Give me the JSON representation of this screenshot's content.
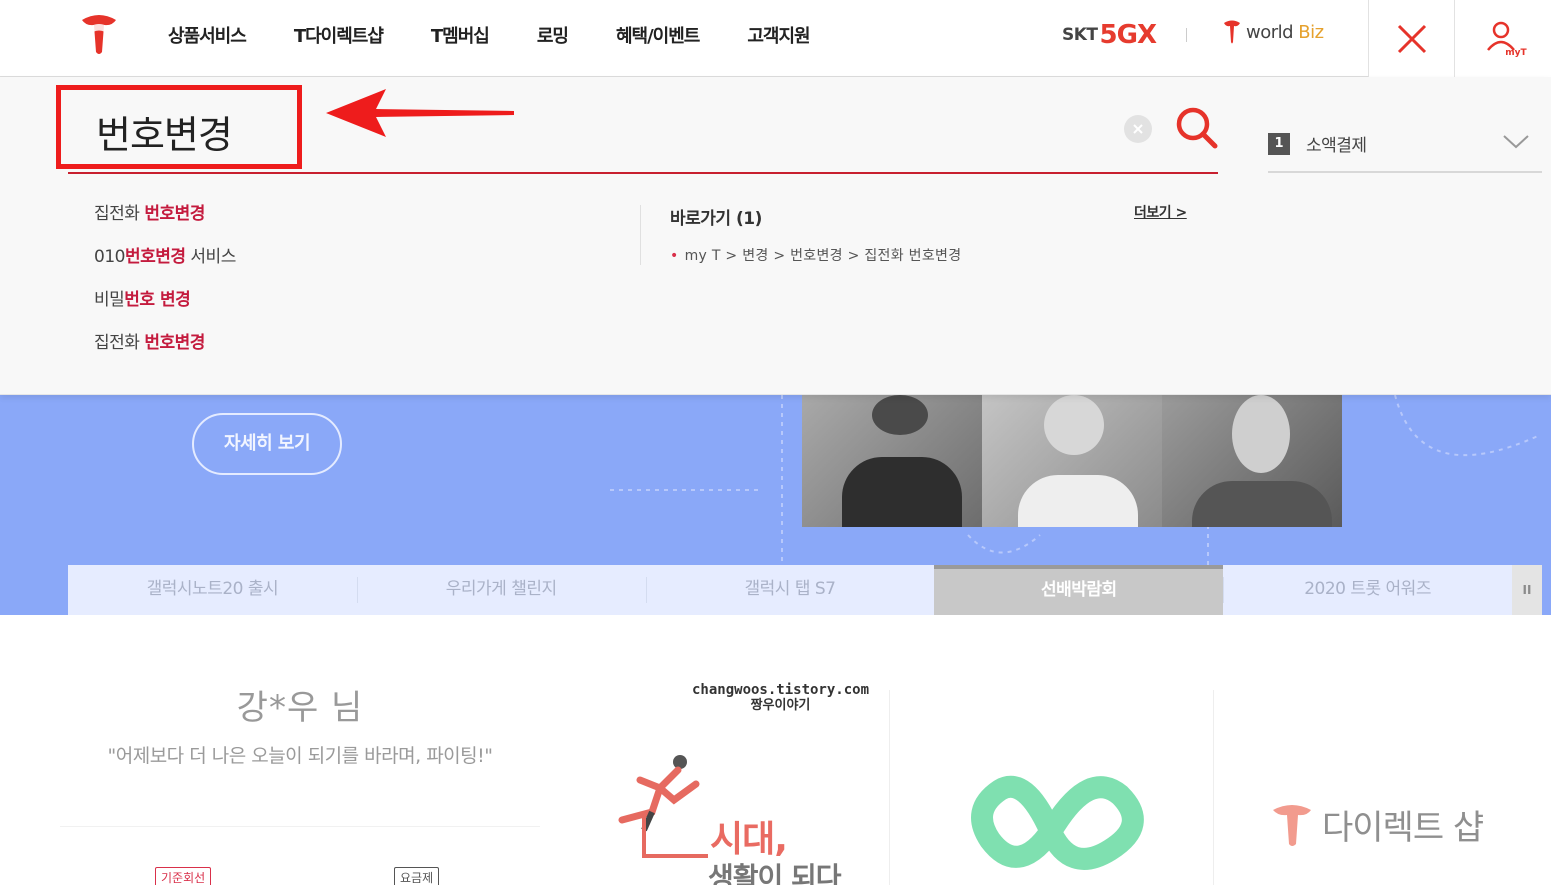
{
  "header": {
    "nav": [
      "상품서비스",
      "T다이렉트샵",
      "T멤버십",
      "로밍",
      "혜택/이벤트",
      "고객지원"
    ],
    "brand_skt": "SKT",
    "brand_5gx": "5GX",
    "brand_world": "world",
    "brand_biz": "Biz",
    "myt_label": "myT"
  },
  "search": {
    "query": "번호변경",
    "suggestions": [
      {
        "pre": "집전화 ",
        "hl": "번호변경",
        "post": ""
      },
      {
        "pre": "010",
        "hl": "번호변경",
        "post": " 서비스"
      },
      {
        "pre": "비밀",
        "hl": "번호 변경",
        "post": ""
      },
      {
        "pre": "집전화 ",
        "hl": "번호변경",
        "post": ""
      }
    ],
    "shortcut_title": "바로가기 (1)",
    "more": "더보기 >",
    "shortcut_path": "my T > 변경 > 번호변경 > 집전화 번호변경",
    "rank_num": "1",
    "rank_label": "소액결제"
  },
  "banner": {
    "detail_button": "자세히 보기",
    "tabs": [
      "갤럭시노트20 출시",
      "우리가게 챌린지",
      "갤럭시 탭 S7",
      "선배박람회",
      "2020 트롯 어워즈"
    ],
    "active_tab": 3,
    "pause": "II"
  },
  "content": {
    "greeting_name": "강*우 님",
    "greeting_msg": "\"어제보다 더 나은 오늘이 되기를 바라며, 파이팅!\"",
    "tag1": "기준회선",
    "tag2": "요금제",
    "watermark_url": "changwoos.tistory.com",
    "watermark_name": "짱우이야기",
    "promo_line1": "시대,",
    "promo_line2": "생활이 되다",
    "direct_shop": "다이렉트 샵"
  },
  "colors": {
    "brand_red": "#e6332a",
    "highlight": "#c41b3e",
    "banner_blue": "#8aa8f8",
    "annotation_red": "#ee1c1c"
  }
}
